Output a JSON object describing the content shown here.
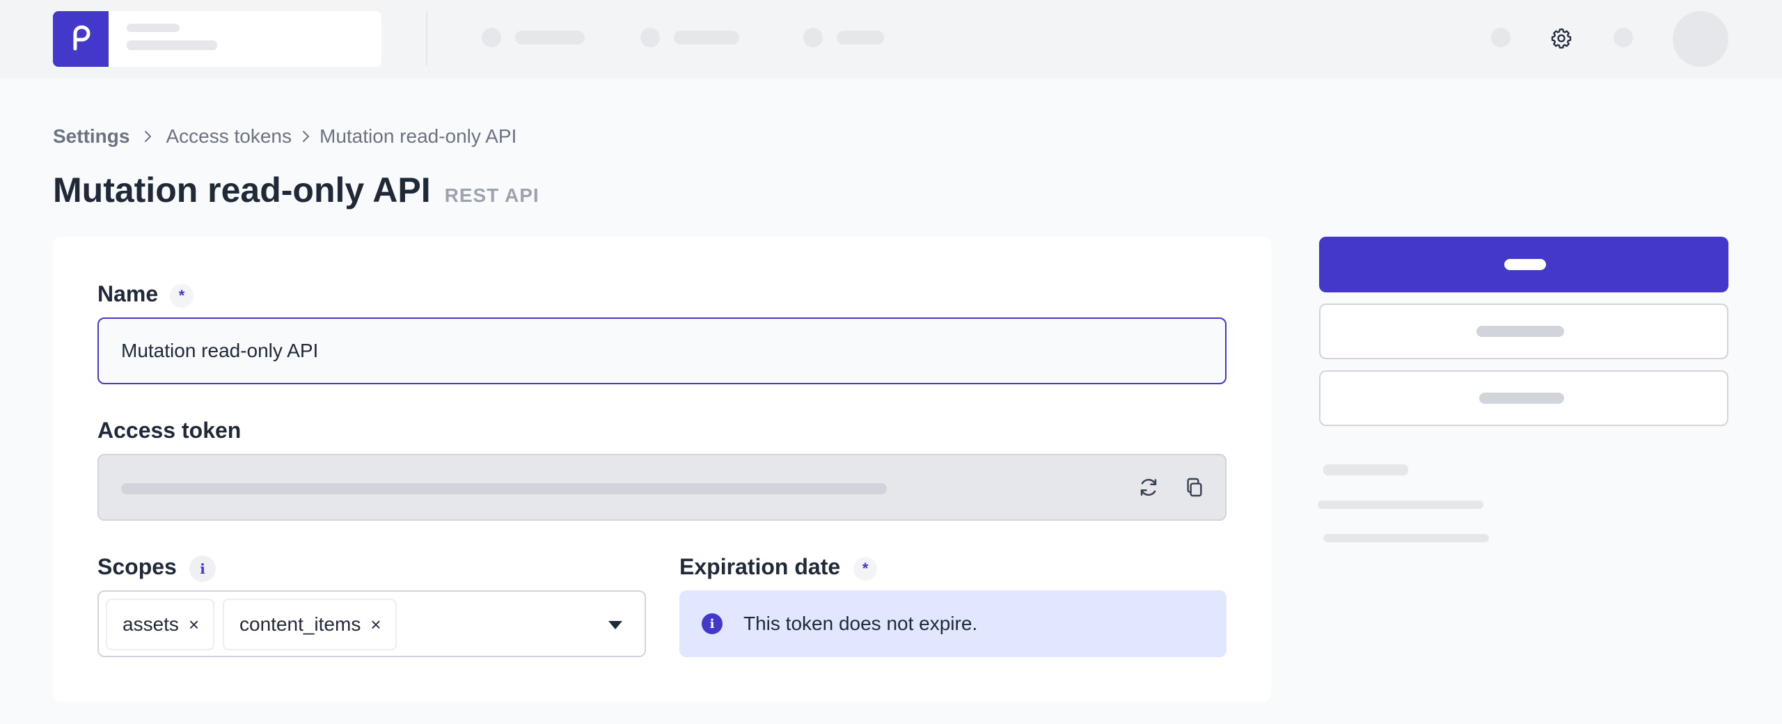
{
  "topbar": {
    "logo_icon": "project-logo-icon",
    "chevron_icon": "chevron-down-icon",
    "settings_icon": "gear-icon",
    "accent": "#4338ca"
  },
  "breadcrumb": {
    "items": [
      "Settings",
      "Access tokens",
      "Mutation read-only API"
    ]
  },
  "page": {
    "title": "Mutation read-only API",
    "subtitle": "REST API"
  },
  "form": {
    "name": {
      "label": "Name",
      "required_mark": "*",
      "value": "Mutation read-only API"
    },
    "access_token": {
      "label": "Access token",
      "regenerate_icon": "refresh-icon",
      "copy_icon": "copy-icon"
    },
    "scopes": {
      "label": "Scopes",
      "info_mark": "i",
      "chips": [
        {
          "label": "assets",
          "remove": "×"
        },
        {
          "label": "content_items",
          "remove": "×"
        }
      ],
      "dropdown_icon": "caret-down-icon"
    },
    "expiration": {
      "label": "Expiration date",
      "required_mark": "*",
      "info_mark": "i",
      "message": "This token does not expire."
    }
  }
}
